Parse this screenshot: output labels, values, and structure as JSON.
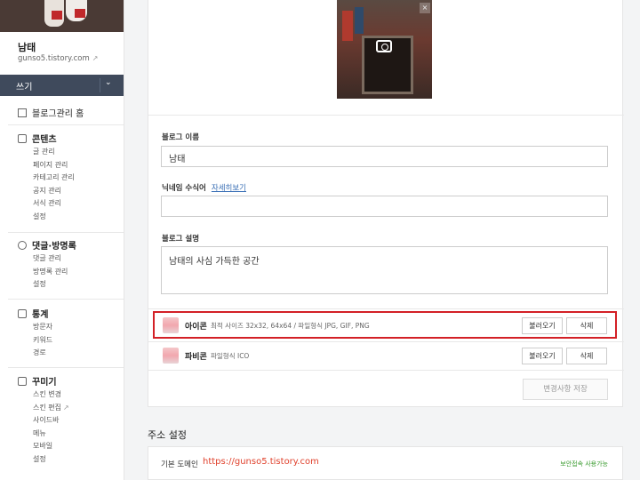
{
  "sidebar": {
    "blog_name": "남태",
    "blog_url": "gunso5.tistory.com",
    "write_label": "쓰기",
    "home_label": "블로그관리 홈",
    "sections": [
      {
        "title": "콘텐츠",
        "icon": "document-icon",
        "items": [
          "글 관리",
          "페이지 관리",
          "카테고리 관리",
          "공지 관리",
          "서식 관리",
          "설정"
        ]
      },
      {
        "title": "댓글·방명록",
        "icon": "comment-icon",
        "items": [
          "댓글 관리",
          "방명록 관리",
          "설정"
        ]
      },
      {
        "title": "통계",
        "icon": "bar-chart-icon",
        "items": [
          "방문자",
          "키워드",
          "경로"
        ]
      },
      {
        "title": "꾸미기",
        "icon": "decorate-icon",
        "items": [
          "스킨 변경",
          "스킨 편집",
          "사이드바",
          "메뉴",
          "모바일",
          "설정"
        ]
      }
    ]
  },
  "form": {
    "blog_name_label": "블로그 이름",
    "blog_name_value": "남태",
    "nickname_label": "닉네임 수식어",
    "nickname_link": "자세히보기",
    "nickname_value": "",
    "desc_label": "블로그 설명",
    "desc_value": "남태의 사심 가득한 공간",
    "icon_row": {
      "name": "아이콘",
      "desc": "최적 사이즈 32x32, 64x64 / 파일형식 JPG, GIF, PNG",
      "load": "불러오기",
      "delete": "삭제"
    },
    "favicon_row": {
      "name": "파비콘",
      "desc": "파일형식 ICO",
      "load": "불러오기",
      "delete": "삭제"
    },
    "save_label": "변경사항 저장"
  },
  "address": {
    "title": "주소 설정",
    "default_domain_label": "기본 도메인",
    "default_domain_url": "https://gunso5.tistory.com",
    "status": "보안접속 사용가능"
  },
  "colors": {
    "accent_red": "#d32026",
    "write_bg": "#3f4a5c",
    "url_color": "#e0412c",
    "status_green": "#3a9b2f"
  }
}
